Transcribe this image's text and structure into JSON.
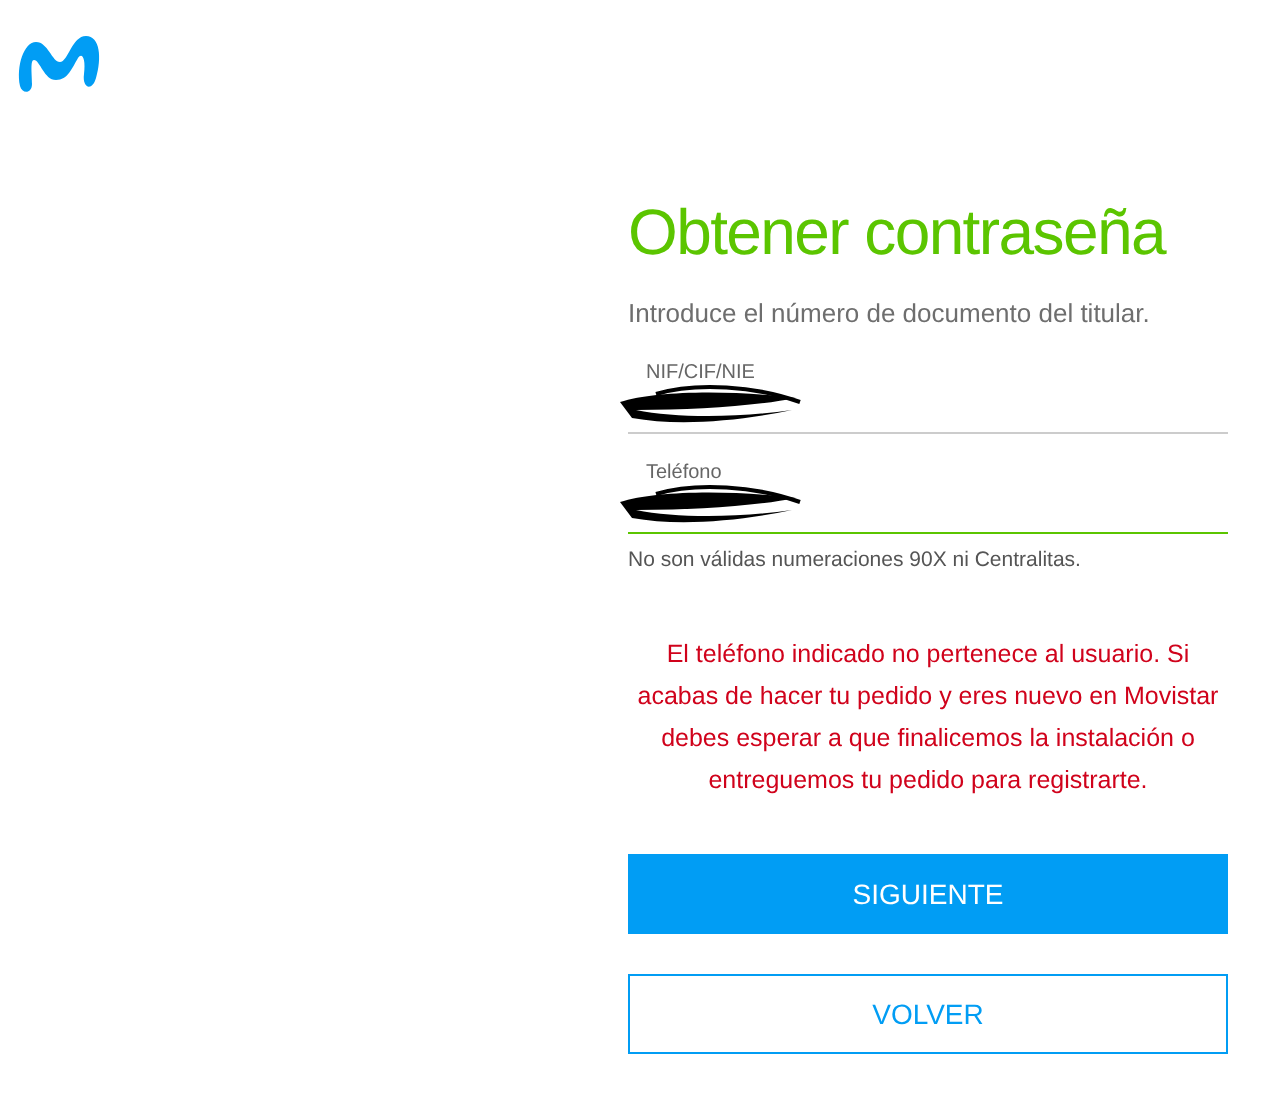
{
  "title": "Obtener contraseña",
  "intro": "Introduce el número de documento del titular.",
  "fields": [
    {
      "label": "NIF/CIF/NIE",
      "focused": false,
      "redacted": true
    },
    {
      "label": "Teléfono",
      "focused": true,
      "redacted": true
    }
  ],
  "hint": "No son válidas numeraciones 90X ni Centralitas.",
  "error": "El teléfono indicado no pertenece al usuario. Si acabas de hacer tu pedido y eres nuevo en Movistar debes esperar a que finalicemos la instalación o entreguemos tu pedido para registrarte.",
  "buttons": [
    {
      "label": "SIGUIENTE",
      "kind": "primary"
    },
    {
      "label": "VOLVER",
      "kind": "secondary"
    }
  ]
}
